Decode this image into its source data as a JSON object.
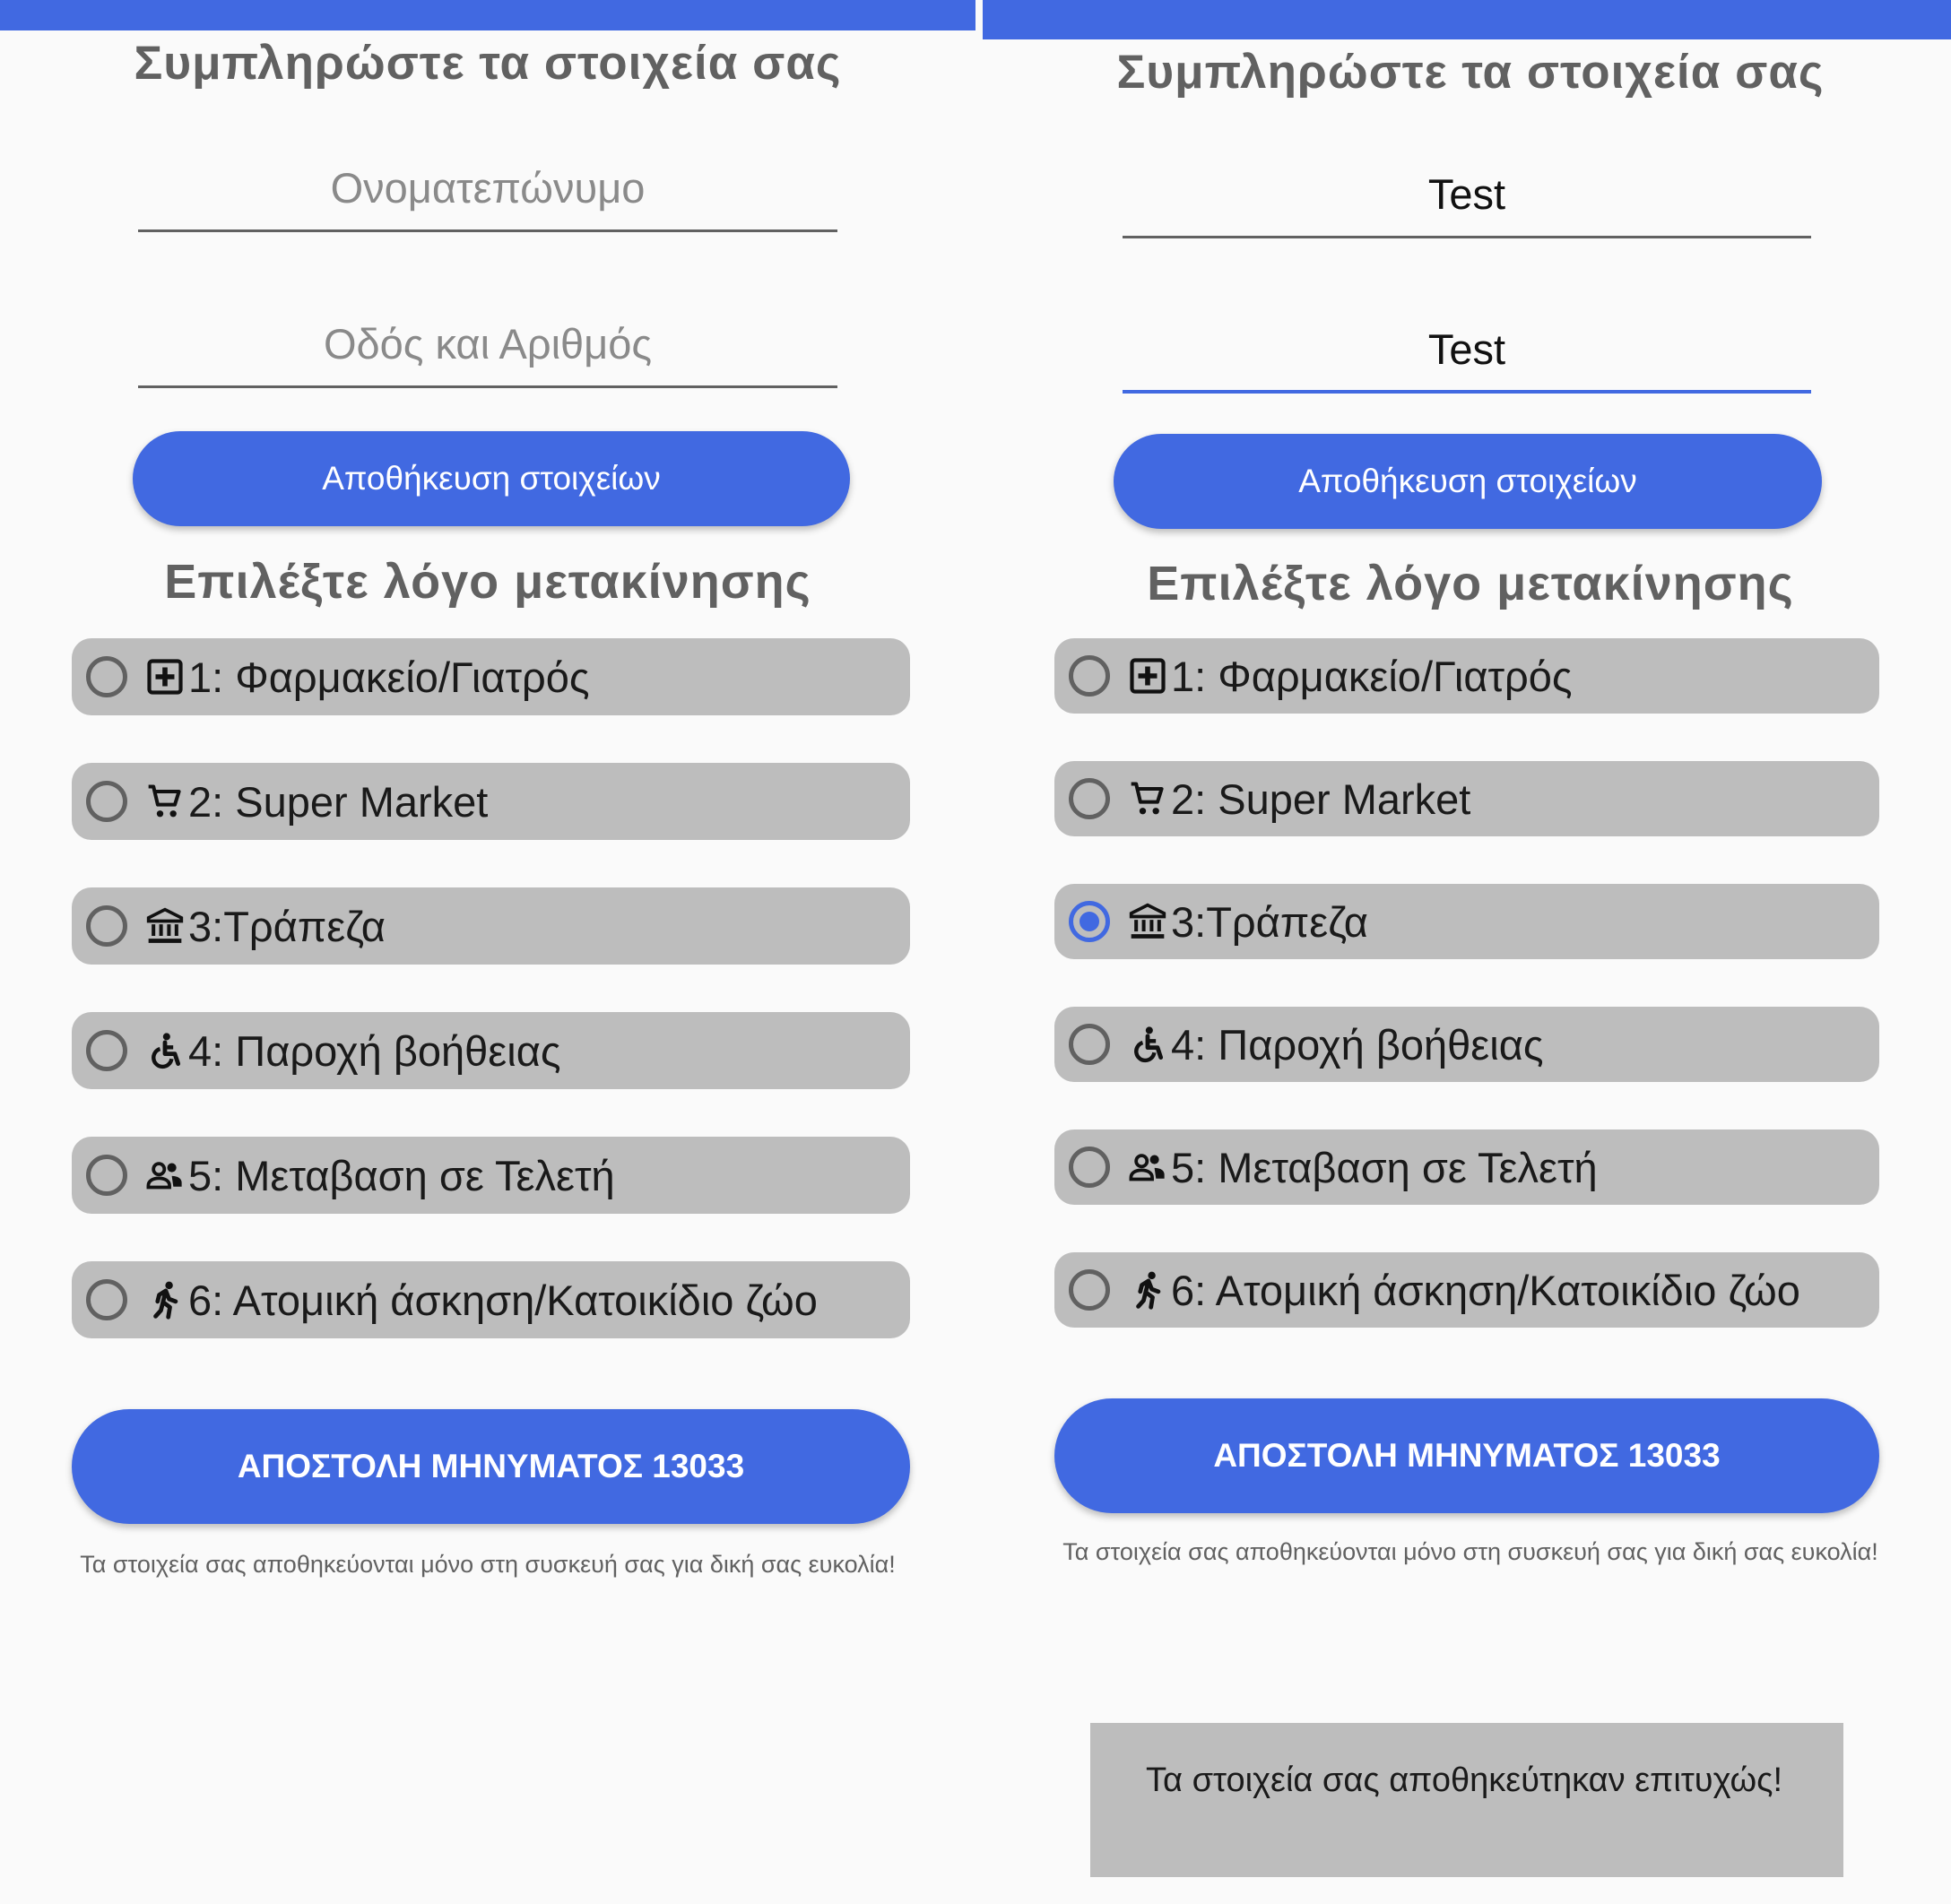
{
  "colors": {
    "accent": "#4169e1",
    "option_bg": "#bdbdbd",
    "background": "#fafafa",
    "title_text": "#616161"
  },
  "left": {
    "title": "Συμπληρώστε τα στοιχεία σας",
    "name_field": {
      "value": "",
      "placeholder": "Ονοματεπώνυμο"
    },
    "address_field": {
      "value": "",
      "placeholder": "Οδός και Αριθμός"
    },
    "save_label": "Αποθήκευση στοιχείων",
    "reason_heading": "Επιλέξτε λόγο μετακίνησης",
    "options": [
      {
        "label": "1: Φαρμακείο/Γιατρός",
        "icon": "medical-cross-icon",
        "checked": false
      },
      {
        "label": "2: Super Market",
        "icon": "shopping-cart-icon",
        "checked": false
      },
      {
        "label": "3:Τράπεζα",
        "icon": "bank-icon",
        "checked": false
      },
      {
        "label": "4: Παροχή βοήθειας",
        "icon": "accessibility-icon",
        "checked": false
      },
      {
        "label": "5: Μεταβαση σε Τελετή",
        "icon": "people-icon",
        "checked": false
      },
      {
        "label": "6: Ατομική άσκηση/Κατοικίδιο ζώο",
        "icon": "running-icon",
        "checked": false
      }
    ],
    "send_label": "ΑΠΟΣΤΟΛΗ ΜΗΝΥΜΑΤΟΣ 13033",
    "footnote": "Τα στοιχεία σας αποθηκεύονται μόνο στη συσκευή σας για δική σας ευκολία!"
  },
  "right": {
    "title": "Συμπληρώστε τα στοιχεία σας",
    "name_field": {
      "value": "Test",
      "placeholder": "Ονοματεπώνυμο"
    },
    "address_field": {
      "value": "Test",
      "placeholder": "Οδός και Αριθμός"
    },
    "save_label": "Αποθήκευση στοιχείων",
    "reason_heading": "Επιλέξτε λόγο μετακίνησης",
    "options": [
      {
        "label": "1: Φαρμακείο/Γιατρός",
        "icon": "medical-cross-icon",
        "checked": false
      },
      {
        "label": "2: Super Market",
        "icon": "shopping-cart-icon",
        "checked": false
      },
      {
        "label": "3:Τράπεζα",
        "icon": "bank-icon",
        "checked": true
      },
      {
        "label": "4: Παροχή βοήθειας",
        "icon": "accessibility-icon",
        "checked": false
      },
      {
        "label": "5: Μεταβαση σε Τελετή",
        "icon": "people-icon",
        "checked": false
      },
      {
        "label": "6: Ατομική άσκηση/Κατοικίδιο ζώο",
        "icon": "running-icon",
        "checked": false
      }
    ],
    "send_label": "ΑΠΟΣΤΟΛΗ ΜΗΝΥΜΑΤΟΣ 13033",
    "footnote": "Τα στοιχεία σας αποθηκεύονται μόνο στη συσκευή σας για δική σας ευκολία!",
    "toast": "Τα στοιχεία σας αποθηκεύτηκαν επιτυχώς!"
  }
}
